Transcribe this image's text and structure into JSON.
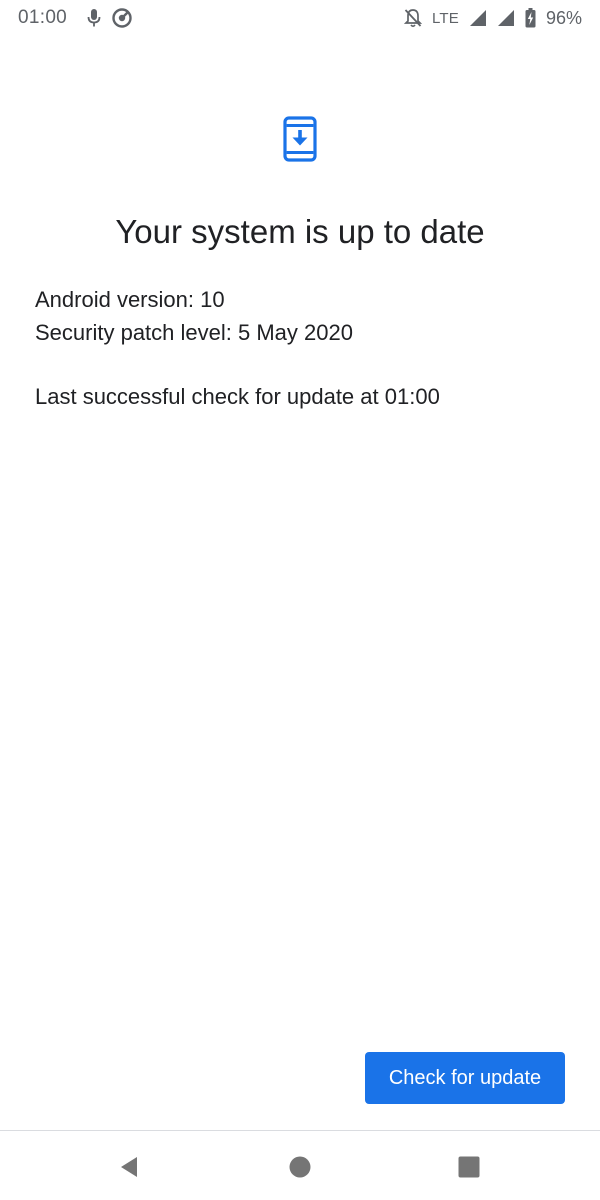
{
  "status_bar": {
    "time": "01:00",
    "network": "LTE",
    "battery": "96%",
    "icons": [
      "mic-icon",
      "data-saver-icon",
      "notifications-off-icon",
      "signal-icon",
      "signal-icon",
      "battery-charging-icon"
    ]
  },
  "main": {
    "icon": "system-update-icon",
    "title": "Your system is up to date",
    "android_version": "Android version: 10",
    "security_patch": "Security patch level: 5 May 2020",
    "last_check": "Last successful check for update at 01:00"
  },
  "actions": {
    "check_update_label": "Check for update"
  },
  "nav_bar": {
    "icons": [
      "back-icon",
      "home-icon",
      "recents-icon"
    ]
  },
  "colors": {
    "accent": "#1a73e8",
    "text_primary": "#202124",
    "status_text": "#5f6368",
    "nav_icon": "#757575"
  }
}
